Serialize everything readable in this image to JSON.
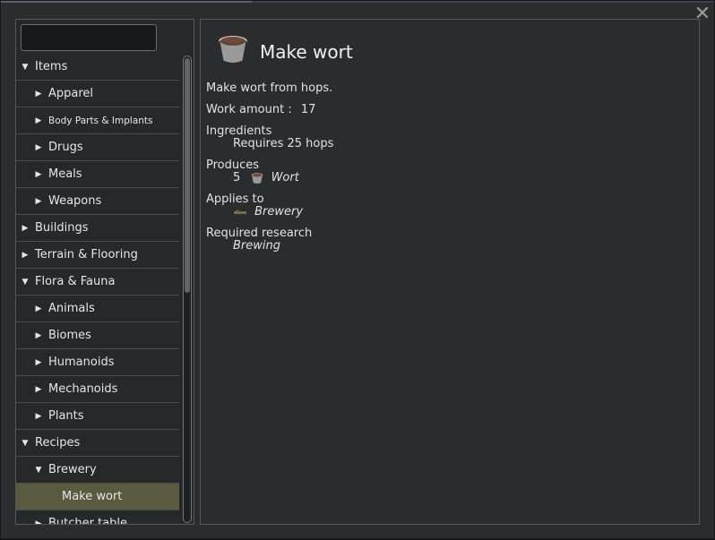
{
  "search": {
    "value": "",
    "placeholder": ""
  },
  "tree": [
    {
      "label": "Items",
      "level": 0,
      "expanded": true
    },
    {
      "label": "Apparel",
      "level": 1,
      "expanded": false
    },
    {
      "label": "Body Parts & Implants",
      "level": 1,
      "expanded": false,
      "small": true
    },
    {
      "label": "Drugs",
      "level": 1,
      "expanded": false
    },
    {
      "label": "Meals",
      "level": 1,
      "expanded": false
    },
    {
      "label": "Weapons",
      "level": 1,
      "expanded": false
    },
    {
      "label": "Buildings",
      "level": 0,
      "expanded": false
    },
    {
      "label": "Terrain & Flooring",
      "level": 0,
      "expanded": false
    },
    {
      "label": "Flora & Fauna",
      "level": 0,
      "expanded": true
    },
    {
      "label": "Animals",
      "level": 1,
      "expanded": false
    },
    {
      "label": "Biomes",
      "level": 1,
      "expanded": false
    },
    {
      "label": "Humanoids",
      "level": 1,
      "expanded": false
    },
    {
      "label": "Mechanoids",
      "level": 1,
      "expanded": false
    },
    {
      "label": "Plants",
      "level": 1,
      "expanded": false
    },
    {
      "label": "Recipes",
      "level": 0,
      "expanded": true
    },
    {
      "label": "Brewery",
      "level": 1,
      "expanded": true
    },
    {
      "label": "Make wort",
      "level": 2,
      "leaf": true,
      "selected": true
    },
    {
      "label": "Butcher table",
      "level": 1,
      "expanded": false
    }
  ],
  "detail": {
    "title": "Make wort",
    "description": "Make wort from hops.",
    "work_amount_label": "Work amount :",
    "work_amount_value": "17",
    "ingredients_label": "Ingredients",
    "ingredients_value": "Requires 25 hops",
    "produces_label": "Produces",
    "produces_count": "5",
    "produces_item": "Wort",
    "applies_label": "Applies to",
    "applies_item": "Brewery",
    "research_label": "Required research",
    "research_item": "Brewing"
  },
  "colors": {
    "selected_row": "#5a5a3e",
    "panel_bg": "#2a2c2e"
  },
  "icons": {
    "close": "close-icon",
    "title": "wort-bucket-icon"
  }
}
